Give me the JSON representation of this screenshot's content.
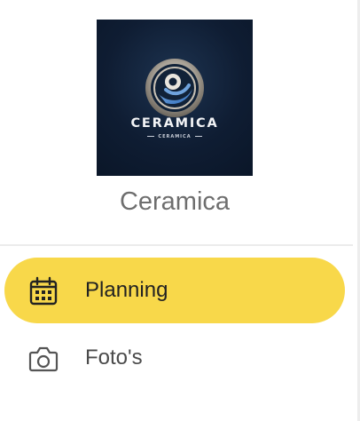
{
  "company": {
    "logo_text": "CERAMICA",
    "logo_subtext": "CERAMICA",
    "name": "Ceramica"
  },
  "nav": {
    "items": [
      {
        "label": "Planning",
        "icon": "calendar-icon",
        "active": true
      },
      {
        "label": "Foto's",
        "icon": "camera-icon",
        "active": false
      }
    ]
  },
  "colors": {
    "accent": "#f8d84a",
    "logo_bg": "#0f1d33"
  }
}
